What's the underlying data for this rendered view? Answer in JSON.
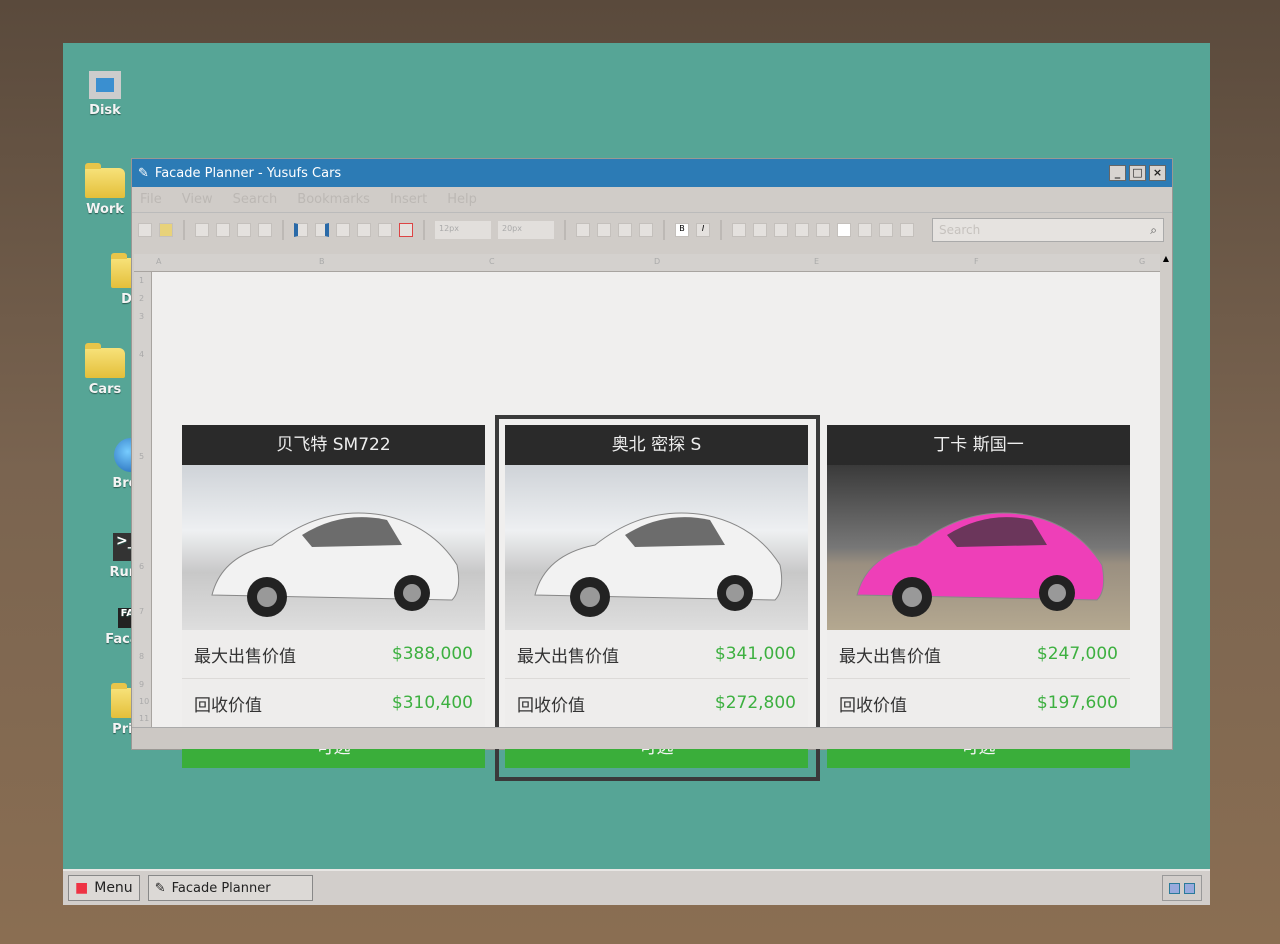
{
  "desktop": {
    "icons": [
      {
        "label": "Disk",
        "icon": "computer-icon"
      },
      {
        "label": "Work",
        "icon": "folder-icon"
      },
      {
        "label": "Do",
        "icon": "folder-icon"
      },
      {
        "label": "Cars",
        "icon": "folder-icon"
      },
      {
        "label": "Brow",
        "icon": "globe-icon"
      },
      {
        "label": "Run.C",
        "icon": "terminal-icon"
      },
      {
        "label": "Facade",
        "icon": "facade-icon"
      },
      {
        "label": "Priva",
        "icon": "folder-icon"
      }
    ]
  },
  "window": {
    "title": "Facade Planner - Yusufs Cars",
    "menu": [
      "File",
      "View",
      "Search",
      "Bookmarks",
      "Insert",
      "Help"
    ],
    "font_size": "12px",
    "line_height": "20px",
    "search_placeholder": "Search",
    "bold": "B",
    "italic": "I"
  },
  "sheet": {
    "columns": [
      "A",
      "B",
      "C",
      "D",
      "E",
      "F",
      "G"
    ],
    "rows": [
      "1",
      "2",
      "3",
      "4",
      "5",
      "6",
      "7",
      "8",
      "9",
      "10",
      "11"
    ]
  },
  "cars": [
    {
      "name": "贝飞特 SM722",
      "max_sale_label": "最大出售价值",
      "max_sale": "$388,000",
      "salvage_label": "回收价值",
      "salvage": "$310,400",
      "button": "可选",
      "color": "#f2f2f2"
    },
    {
      "name": "奥北 密探 S",
      "max_sale_label": "最大出售价值",
      "max_sale": "$341,000",
      "salvage_label": "回收价值",
      "salvage": "$272,800",
      "button": "可选",
      "color": "#f2f2f2",
      "selected": true
    },
    {
      "name": "丁卡 斯国一",
      "max_sale_label": "最大出售价值",
      "max_sale": "$247,000",
      "salvage_label": "回收价值",
      "salvage": "$197,600",
      "button": "可选",
      "color": "#ee3fb8"
    }
  ],
  "colors": {
    "accent": "#3aae3a",
    "price": "#3db040",
    "titlebar": "#2c7bb5",
    "desktop": "#56a596"
  },
  "taskbar": {
    "menu": "Menu",
    "app": "Facade Planner"
  }
}
